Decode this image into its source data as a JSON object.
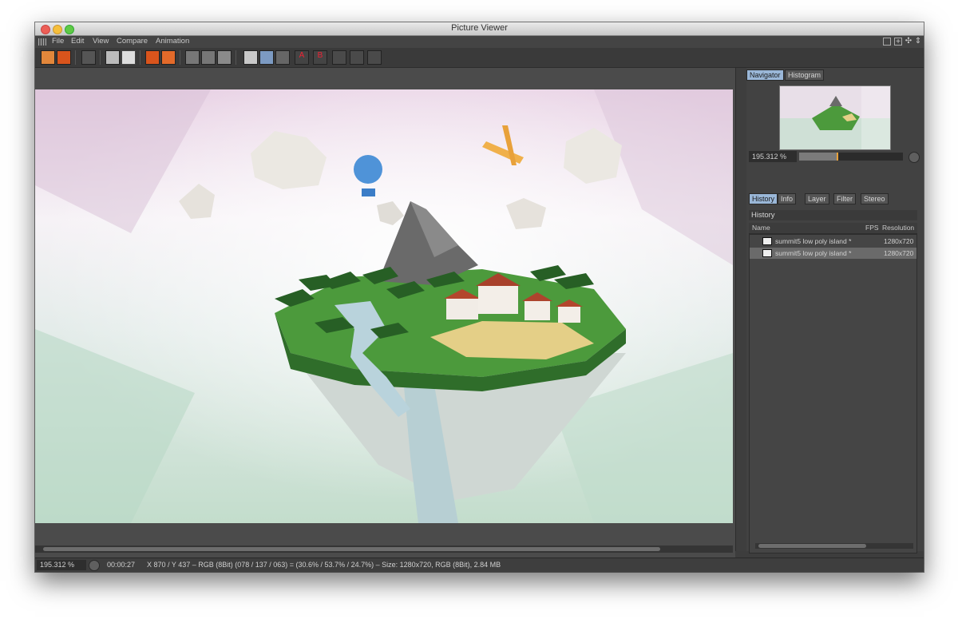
{
  "window": {
    "title": "Picture Viewer"
  },
  "menu": [
    "File",
    "Edit",
    "View",
    "Compare",
    "Animation"
  ],
  "panel": {
    "top_tabs": [
      "Navigator",
      "Histogram"
    ],
    "zoom": "195.312 %",
    "zoom_fill_fraction": 0.36,
    "mid_tabs": [
      "History",
      "Info",
      "Layer",
      "Filter",
      "Stereo"
    ],
    "section_title": "History",
    "columns": {
      "name": "Name",
      "fps": "FPS",
      "resolution": "Resolution"
    },
    "rows": [
      {
        "name": "summit5 low poly island *",
        "resolution": "1280x720"
      },
      {
        "name": "summit5 low poly island *",
        "resolution": "1280x720"
      }
    ]
  },
  "status": {
    "zoom": "195.312 %",
    "time": "00:00:27",
    "info": "X 870 / Y 437 – RGB (8Bit) (078 / 137 / 063) = (30.6% / 53.7% / 24.7%) – Size: 1280x720, RGB (8Bit), 2.84 MB"
  },
  "colors": {
    "accent_orange": "#d9541c",
    "tab_active": "#9ab7d8"
  }
}
